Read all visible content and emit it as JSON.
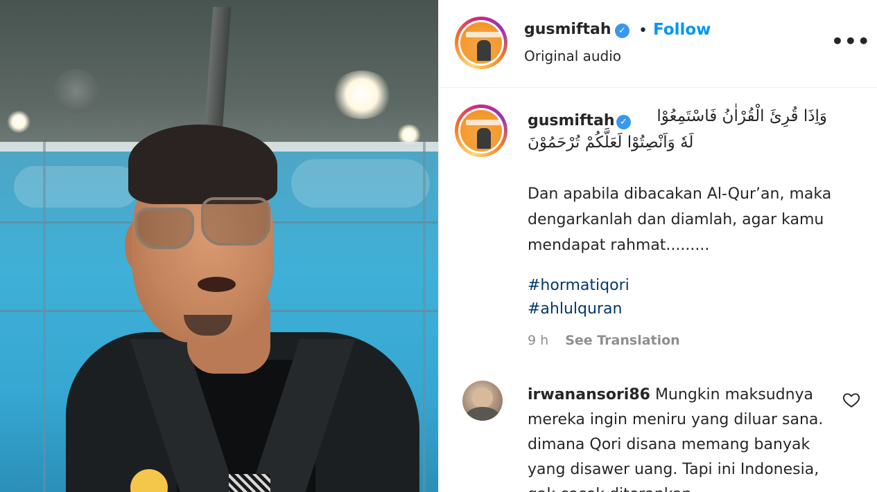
{
  "post": {
    "username": "gusmiftah",
    "follow_label": "Follow",
    "separator": "•",
    "audio_label": "Original audio",
    "more_label": "•••",
    "verified_mark": "✓",
    "caption_arabic_line1": "وَاِذَا قُرِئَ الْقُرْاٰنُ فَاسْتَمِعُوْا",
    "caption_arabic_line2": "لَهٗ وَاَنْصِتُوْا لَعَلَّكُمْ تُرْحَمُوْنَ",
    "caption_text": "Dan apabila dibacakan Al-Qur’an, maka dengarkanlah dan diamlah, agar kamu mendapat rahmat.........",
    "hashtags": [
      "#hormatiqori",
      "#ahlulquran"
    ],
    "time_ago": "9 h",
    "see_translation": "See Translation"
  },
  "comment": {
    "username": "irwanansori86",
    "text": "Mungkin maksudnya mereka ingin meniru yang diluar sana. dimana Qori disana memang banyak yang disawer uang. Tapi ini Indonesia, gak cocok diterapkan"
  },
  "icons": {
    "more": "more-options-icon",
    "heart": "heart-icon",
    "verified": "verified-badge-icon"
  },
  "colors": {
    "link_blue": "#0095f6",
    "hashtag": "#00376b",
    "muted": "#8e8e8e",
    "verified": "#3897f0"
  }
}
